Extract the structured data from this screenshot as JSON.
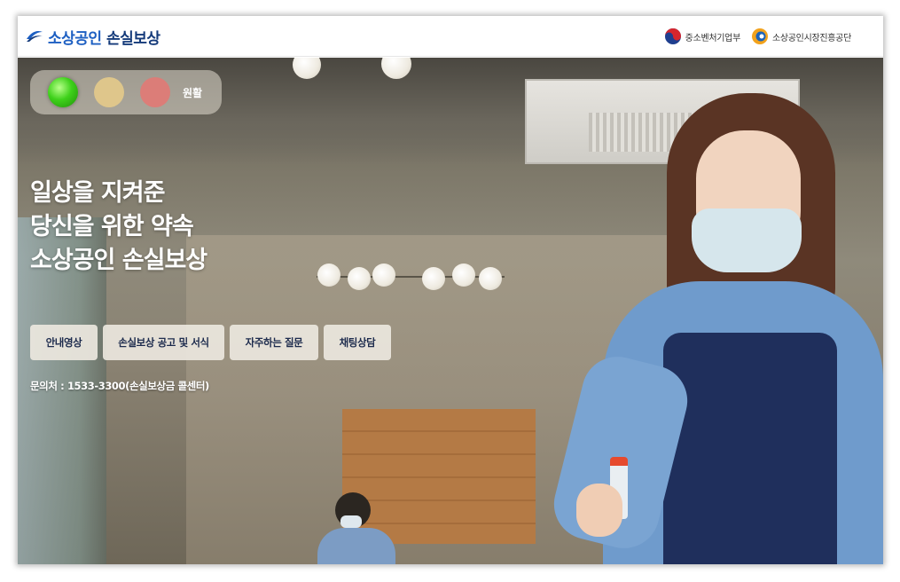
{
  "header": {
    "brand_prefix": "소상공인",
    "brand_suffix": "손실보상",
    "brand_icon": "stripe-logo-icon",
    "orgs": [
      {
        "label": "중소벤처기업부",
        "icon": "taegeuk-emblem-icon"
      },
      {
        "label": "소상공인시장진흥공단",
        "icon": "semes-logo-icon"
      }
    ]
  },
  "status": {
    "label": "원활",
    "lights": [
      "green",
      "yellow",
      "red"
    ],
    "active": "green"
  },
  "hero": {
    "headline": [
      "일상을 지켜준",
      "당신을 위한 약속",
      "소상공인 손실보상"
    ],
    "actions": [
      "안내영상",
      "손실보상 공고 및 서식",
      "자주하는 질문",
      "채팅상담"
    ],
    "contact": "문의처 : 1533-3300(손실보상금 콜센터)"
  },
  "colors": {
    "brand_navy": "#143a7a",
    "brand_blue": "#1d5fc2",
    "button_text": "#1d2b4d",
    "status_green": "#3ed11a"
  }
}
